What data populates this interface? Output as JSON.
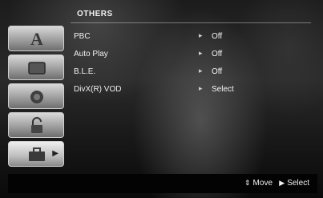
{
  "header": {
    "title": "OTHERS"
  },
  "sidebar": {
    "items": [
      {
        "icon": "text-a-icon",
        "glyph": "A"
      },
      {
        "icon": "screen-icon",
        "glyph": "▭"
      },
      {
        "icon": "speaker-icon",
        "glyph": "◖"
      },
      {
        "icon": "lock-icon",
        "glyph": "🔓"
      },
      {
        "icon": "briefcase-icon",
        "glyph": "▣",
        "selected": true
      }
    ]
  },
  "menu": {
    "rows": [
      {
        "label": "PBC",
        "value": "Off"
      },
      {
        "label": "Auto Play",
        "value": "Off"
      },
      {
        "label": "B.L.E.",
        "value": "Off"
      },
      {
        "label": "DivX(R) VOD",
        "value": "Select"
      }
    ]
  },
  "footer": {
    "move_label": "Move",
    "select_label": "Select"
  }
}
